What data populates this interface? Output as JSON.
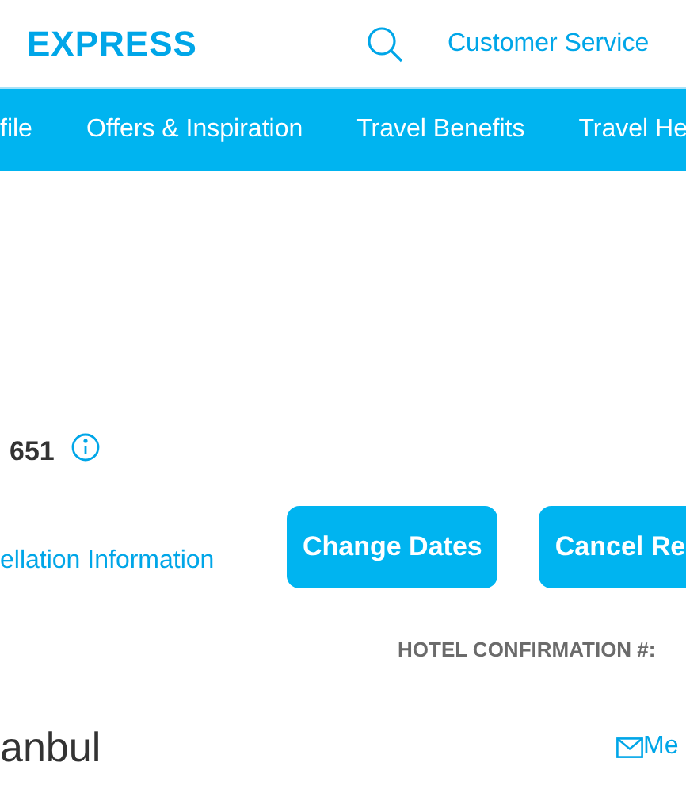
{
  "header": {
    "logo": "EXPRESS",
    "customer_service": "Customer Service"
  },
  "nav": [
    {
      "label": "file"
    },
    {
      "label": "Offers & Inspiration"
    },
    {
      "label": "Travel Benefits"
    },
    {
      "label": "Travel He"
    }
  ],
  "booking": {
    "number": "651",
    "cancellation_link": "ellation Information",
    "buttons": [
      "Change Dates",
      "Cancel Re"
    ],
    "hotel_confirmation_label": "HOTEL CONFIRMATION #:",
    "city": "anbul",
    "message_link": "Me"
  }
}
